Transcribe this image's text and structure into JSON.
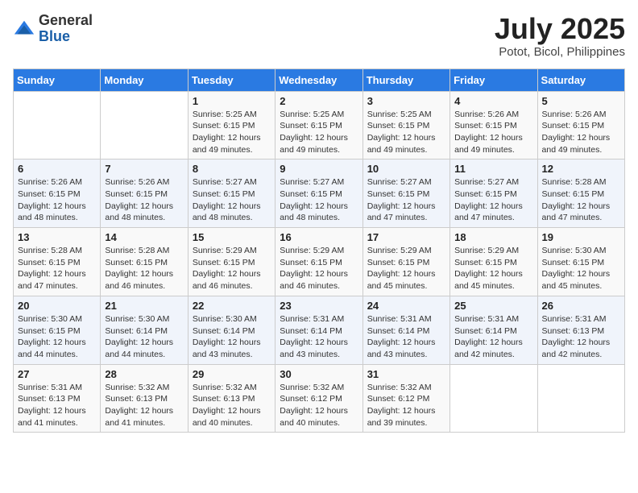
{
  "logo": {
    "general": "General",
    "blue": "Blue"
  },
  "title": "July 2025",
  "location": "Potot, Bicol, Philippines",
  "days_of_week": [
    "Sunday",
    "Monday",
    "Tuesday",
    "Wednesday",
    "Thursday",
    "Friday",
    "Saturday"
  ],
  "weeks": [
    [
      {
        "day": "",
        "info": ""
      },
      {
        "day": "",
        "info": ""
      },
      {
        "day": "1",
        "info": "Sunrise: 5:25 AM\nSunset: 6:15 PM\nDaylight: 12 hours and 49 minutes."
      },
      {
        "day": "2",
        "info": "Sunrise: 5:25 AM\nSunset: 6:15 PM\nDaylight: 12 hours and 49 minutes."
      },
      {
        "day": "3",
        "info": "Sunrise: 5:25 AM\nSunset: 6:15 PM\nDaylight: 12 hours and 49 minutes."
      },
      {
        "day": "4",
        "info": "Sunrise: 5:26 AM\nSunset: 6:15 PM\nDaylight: 12 hours and 49 minutes."
      },
      {
        "day": "5",
        "info": "Sunrise: 5:26 AM\nSunset: 6:15 PM\nDaylight: 12 hours and 49 minutes."
      }
    ],
    [
      {
        "day": "6",
        "info": "Sunrise: 5:26 AM\nSunset: 6:15 PM\nDaylight: 12 hours and 48 minutes."
      },
      {
        "day": "7",
        "info": "Sunrise: 5:26 AM\nSunset: 6:15 PM\nDaylight: 12 hours and 48 minutes."
      },
      {
        "day": "8",
        "info": "Sunrise: 5:27 AM\nSunset: 6:15 PM\nDaylight: 12 hours and 48 minutes."
      },
      {
        "day": "9",
        "info": "Sunrise: 5:27 AM\nSunset: 6:15 PM\nDaylight: 12 hours and 48 minutes."
      },
      {
        "day": "10",
        "info": "Sunrise: 5:27 AM\nSunset: 6:15 PM\nDaylight: 12 hours and 47 minutes."
      },
      {
        "day": "11",
        "info": "Sunrise: 5:27 AM\nSunset: 6:15 PM\nDaylight: 12 hours and 47 minutes."
      },
      {
        "day": "12",
        "info": "Sunrise: 5:28 AM\nSunset: 6:15 PM\nDaylight: 12 hours and 47 minutes."
      }
    ],
    [
      {
        "day": "13",
        "info": "Sunrise: 5:28 AM\nSunset: 6:15 PM\nDaylight: 12 hours and 47 minutes."
      },
      {
        "day": "14",
        "info": "Sunrise: 5:28 AM\nSunset: 6:15 PM\nDaylight: 12 hours and 46 minutes."
      },
      {
        "day": "15",
        "info": "Sunrise: 5:29 AM\nSunset: 6:15 PM\nDaylight: 12 hours and 46 minutes."
      },
      {
        "day": "16",
        "info": "Sunrise: 5:29 AM\nSunset: 6:15 PM\nDaylight: 12 hours and 46 minutes."
      },
      {
        "day": "17",
        "info": "Sunrise: 5:29 AM\nSunset: 6:15 PM\nDaylight: 12 hours and 45 minutes."
      },
      {
        "day": "18",
        "info": "Sunrise: 5:29 AM\nSunset: 6:15 PM\nDaylight: 12 hours and 45 minutes."
      },
      {
        "day": "19",
        "info": "Sunrise: 5:30 AM\nSunset: 6:15 PM\nDaylight: 12 hours and 45 minutes."
      }
    ],
    [
      {
        "day": "20",
        "info": "Sunrise: 5:30 AM\nSunset: 6:15 PM\nDaylight: 12 hours and 44 minutes."
      },
      {
        "day": "21",
        "info": "Sunrise: 5:30 AM\nSunset: 6:14 PM\nDaylight: 12 hours and 44 minutes."
      },
      {
        "day": "22",
        "info": "Sunrise: 5:30 AM\nSunset: 6:14 PM\nDaylight: 12 hours and 43 minutes."
      },
      {
        "day": "23",
        "info": "Sunrise: 5:31 AM\nSunset: 6:14 PM\nDaylight: 12 hours and 43 minutes."
      },
      {
        "day": "24",
        "info": "Sunrise: 5:31 AM\nSunset: 6:14 PM\nDaylight: 12 hours and 43 minutes."
      },
      {
        "day": "25",
        "info": "Sunrise: 5:31 AM\nSunset: 6:14 PM\nDaylight: 12 hours and 42 minutes."
      },
      {
        "day": "26",
        "info": "Sunrise: 5:31 AM\nSunset: 6:13 PM\nDaylight: 12 hours and 42 minutes."
      }
    ],
    [
      {
        "day": "27",
        "info": "Sunrise: 5:31 AM\nSunset: 6:13 PM\nDaylight: 12 hours and 41 minutes."
      },
      {
        "day": "28",
        "info": "Sunrise: 5:32 AM\nSunset: 6:13 PM\nDaylight: 12 hours and 41 minutes."
      },
      {
        "day": "29",
        "info": "Sunrise: 5:32 AM\nSunset: 6:13 PM\nDaylight: 12 hours and 40 minutes."
      },
      {
        "day": "30",
        "info": "Sunrise: 5:32 AM\nSunset: 6:12 PM\nDaylight: 12 hours and 40 minutes."
      },
      {
        "day": "31",
        "info": "Sunrise: 5:32 AM\nSunset: 6:12 PM\nDaylight: 12 hours and 39 minutes."
      },
      {
        "day": "",
        "info": ""
      },
      {
        "day": "",
        "info": ""
      }
    ]
  ]
}
